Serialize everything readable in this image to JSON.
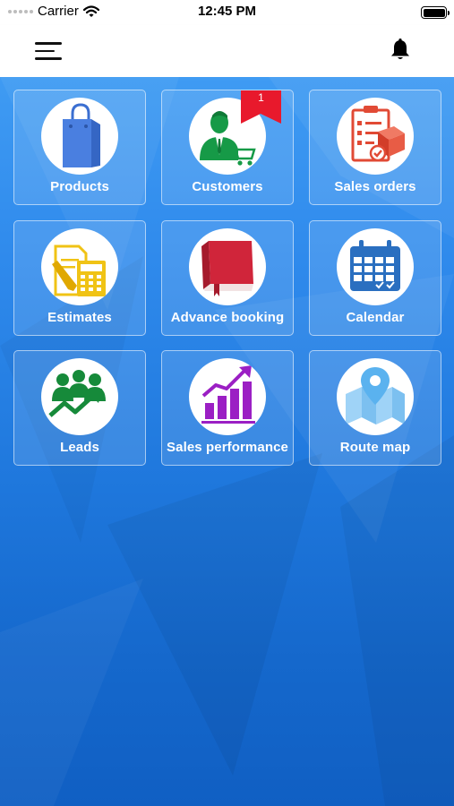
{
  "status_bar": {
    "carrier": "Carrier",
    "time": "12:45 PM",
    "battery_level": 1.0
  },
  "nav": {
    "menu_icon": "hamburger-menu-icon",
    "notification_icon": "bell-icon"
  },
  "colors": {
    "background_top": "#3f9bf3",
    "background_bottom": "#105fc3",
    "badge": "#e8192c",
    "products_icon": "#4a7fe0",
    "customers_icon": "#169a47",
    "sales_orders_icon": "#e14a35",
    "estimates_icon": "#f0c315",
    "advance_booking_icon": "#d0253a",
    "calendar_icon": "#2a6fc0",
    "leads_icon": "#168a3a",
    "sales_performance_icon": "#9b1fc4",
    "route_map_icon": "#5ab2ef"
  },
  "tiles": [
    {
      "label": "Products",
      "icon": "shopping-bag-icon"
    },
    {
      "label": "Customers",
      "icon": "customer-cart-icon",
      "badge": "1"
    },
    {
      "label": "Sales orders",
      "icon": "clipboard-order-icon"
    },
    {
      "label": "Estimates",
      "icon": "estimate-calculator-icon"
    },
    {
      "label": "Advance booking",
      "icon": "book-icon"
    },
    {
      "label": "Calendar",
      "icon": "calendar-icon"
    },
    {
      "label": "Leads",
      "icon": "leads-growth-icon"
    },
    {
      "label": "Sales performance",
      "icon": "bar-chart-growth-icon"
    },
    {
      "label": "Route map",
      "icon": "map-pin-icon"
    }
  ]
}
